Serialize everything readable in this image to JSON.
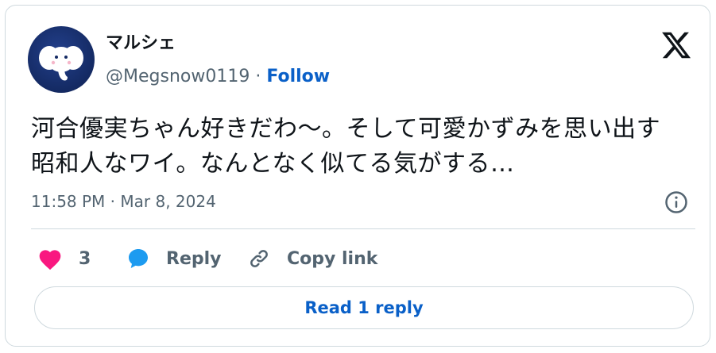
{
  "author": {
    "display_name": "マルシェ",
    "handle": "@Megsnow0119",
    "separator": "·",
    "follow_label": "Follow",
    "avatar_icon": "elephant-avatar"
  },
  "brand": {
    "logo_icon": "x-logo-icon"
  },
  "tweet": {
    "text": "河合優実ちゃん好きだわ〜。そして可愛かずみを思い出す昭和人なワイ。なんとなく似てる気がする…",
    "timestamp": "11:58 PM · Mar 8, 2024"
  },
  "actions": {
    "like_count": "3",
    "reply_label": "Reply",
    "copy_link_label": "Copy link"
  },
  "footer": {
    "read_replies_label": "Read 1 reply"
  },
  "colors": {
    "like": "#f91880",
    "reply": "#1d9bf0",
    "link": "#0a60c8",
    "muted": "#536471"
  }
}
